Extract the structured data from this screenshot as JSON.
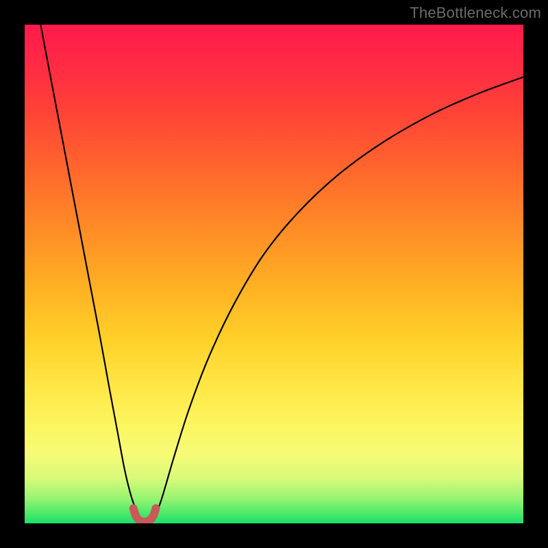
{
  "watermark": {
    "text": "TheBottleneck.com"
  },
  "chart_data": {
    "type": "line",
    "title": "",
    "xlabel": "",
    "ylabel": "",
    "xlim": [
      0,
      1
    ],
    "ylim": [
      0,
      1
    ],
    "background_gradient": {
      "direction": "vertical",
      "stops": [
        {
          "pos": 0.0,
          "color": "#ff1a4b"
        },
        {
          "pos": 0.18,
          "color": "#ff4436"
        },
        {
          "pos": 0.42,
          "color": "#ff8f26"
        },
        {
          "pos": 0.63,
          "color": "#ffd028"
        },
        {
          "pos": 0.8,
          "color": "#fcf55f"
        },
        {
          "pos": 0.91,
          "color": "#d8fa7a"
        },
        {
          "pos": 1.0,
          "color": "#19e06a"
        }
      ]
    },
    "series": [
      {
        "name": "left-branch",
        "color": "#000000",
        "width": 2.2,
        "x": [
          0.032,
          0.05,
          0.07,
          0.09,
          0.11,
          0.13,
          0.15,
          0.17,
          0.185,
          0.2,
          0.212,
          0.222,
          0.23
        ],
        "y": [
          1.0,
          0.905,
          0.8,
          0.695,
          0.59,
          0.485,
          0.38,
          0.27,
          0.19,
          0.11,
          0.06,
          0.03,
          0.01
        ]
      },
      {
        "name": "right-branch",
        "color": "#000000",
        "width": 2.2,
        "x": [
          0.26,
          0.275,
          0.3,
          0.33,
          0.37,
          0.42,
          0.48,
          0.55,
          0.63,
          0.72,
          0.82,
          0.91,
          1.0
        ],
        "y": [
          0.01,
          0.05,
          0.135,
          0.23,
          0.335,
          0.44,
          0.54,
          0.625,
          0.7,
          0.765,
          0.822,
          0.862,
          0.895
        ]
      },
      {
        "name": "valley-floor-marker",
        "color": "#c85a5a",
        "width": 12,
        "linecap": "round",
        "x": [
          0.218,
          0.223,
          0.23,
          0.24,
          0.25,
          0.258,
          0.263
        ],
        "y": [
          0.03,
          0.015,
          0.006,
          0.003,
          0.006,
          0.015,
          0.03
        ]
      }
    ],
    "annotations": []
  }
}
